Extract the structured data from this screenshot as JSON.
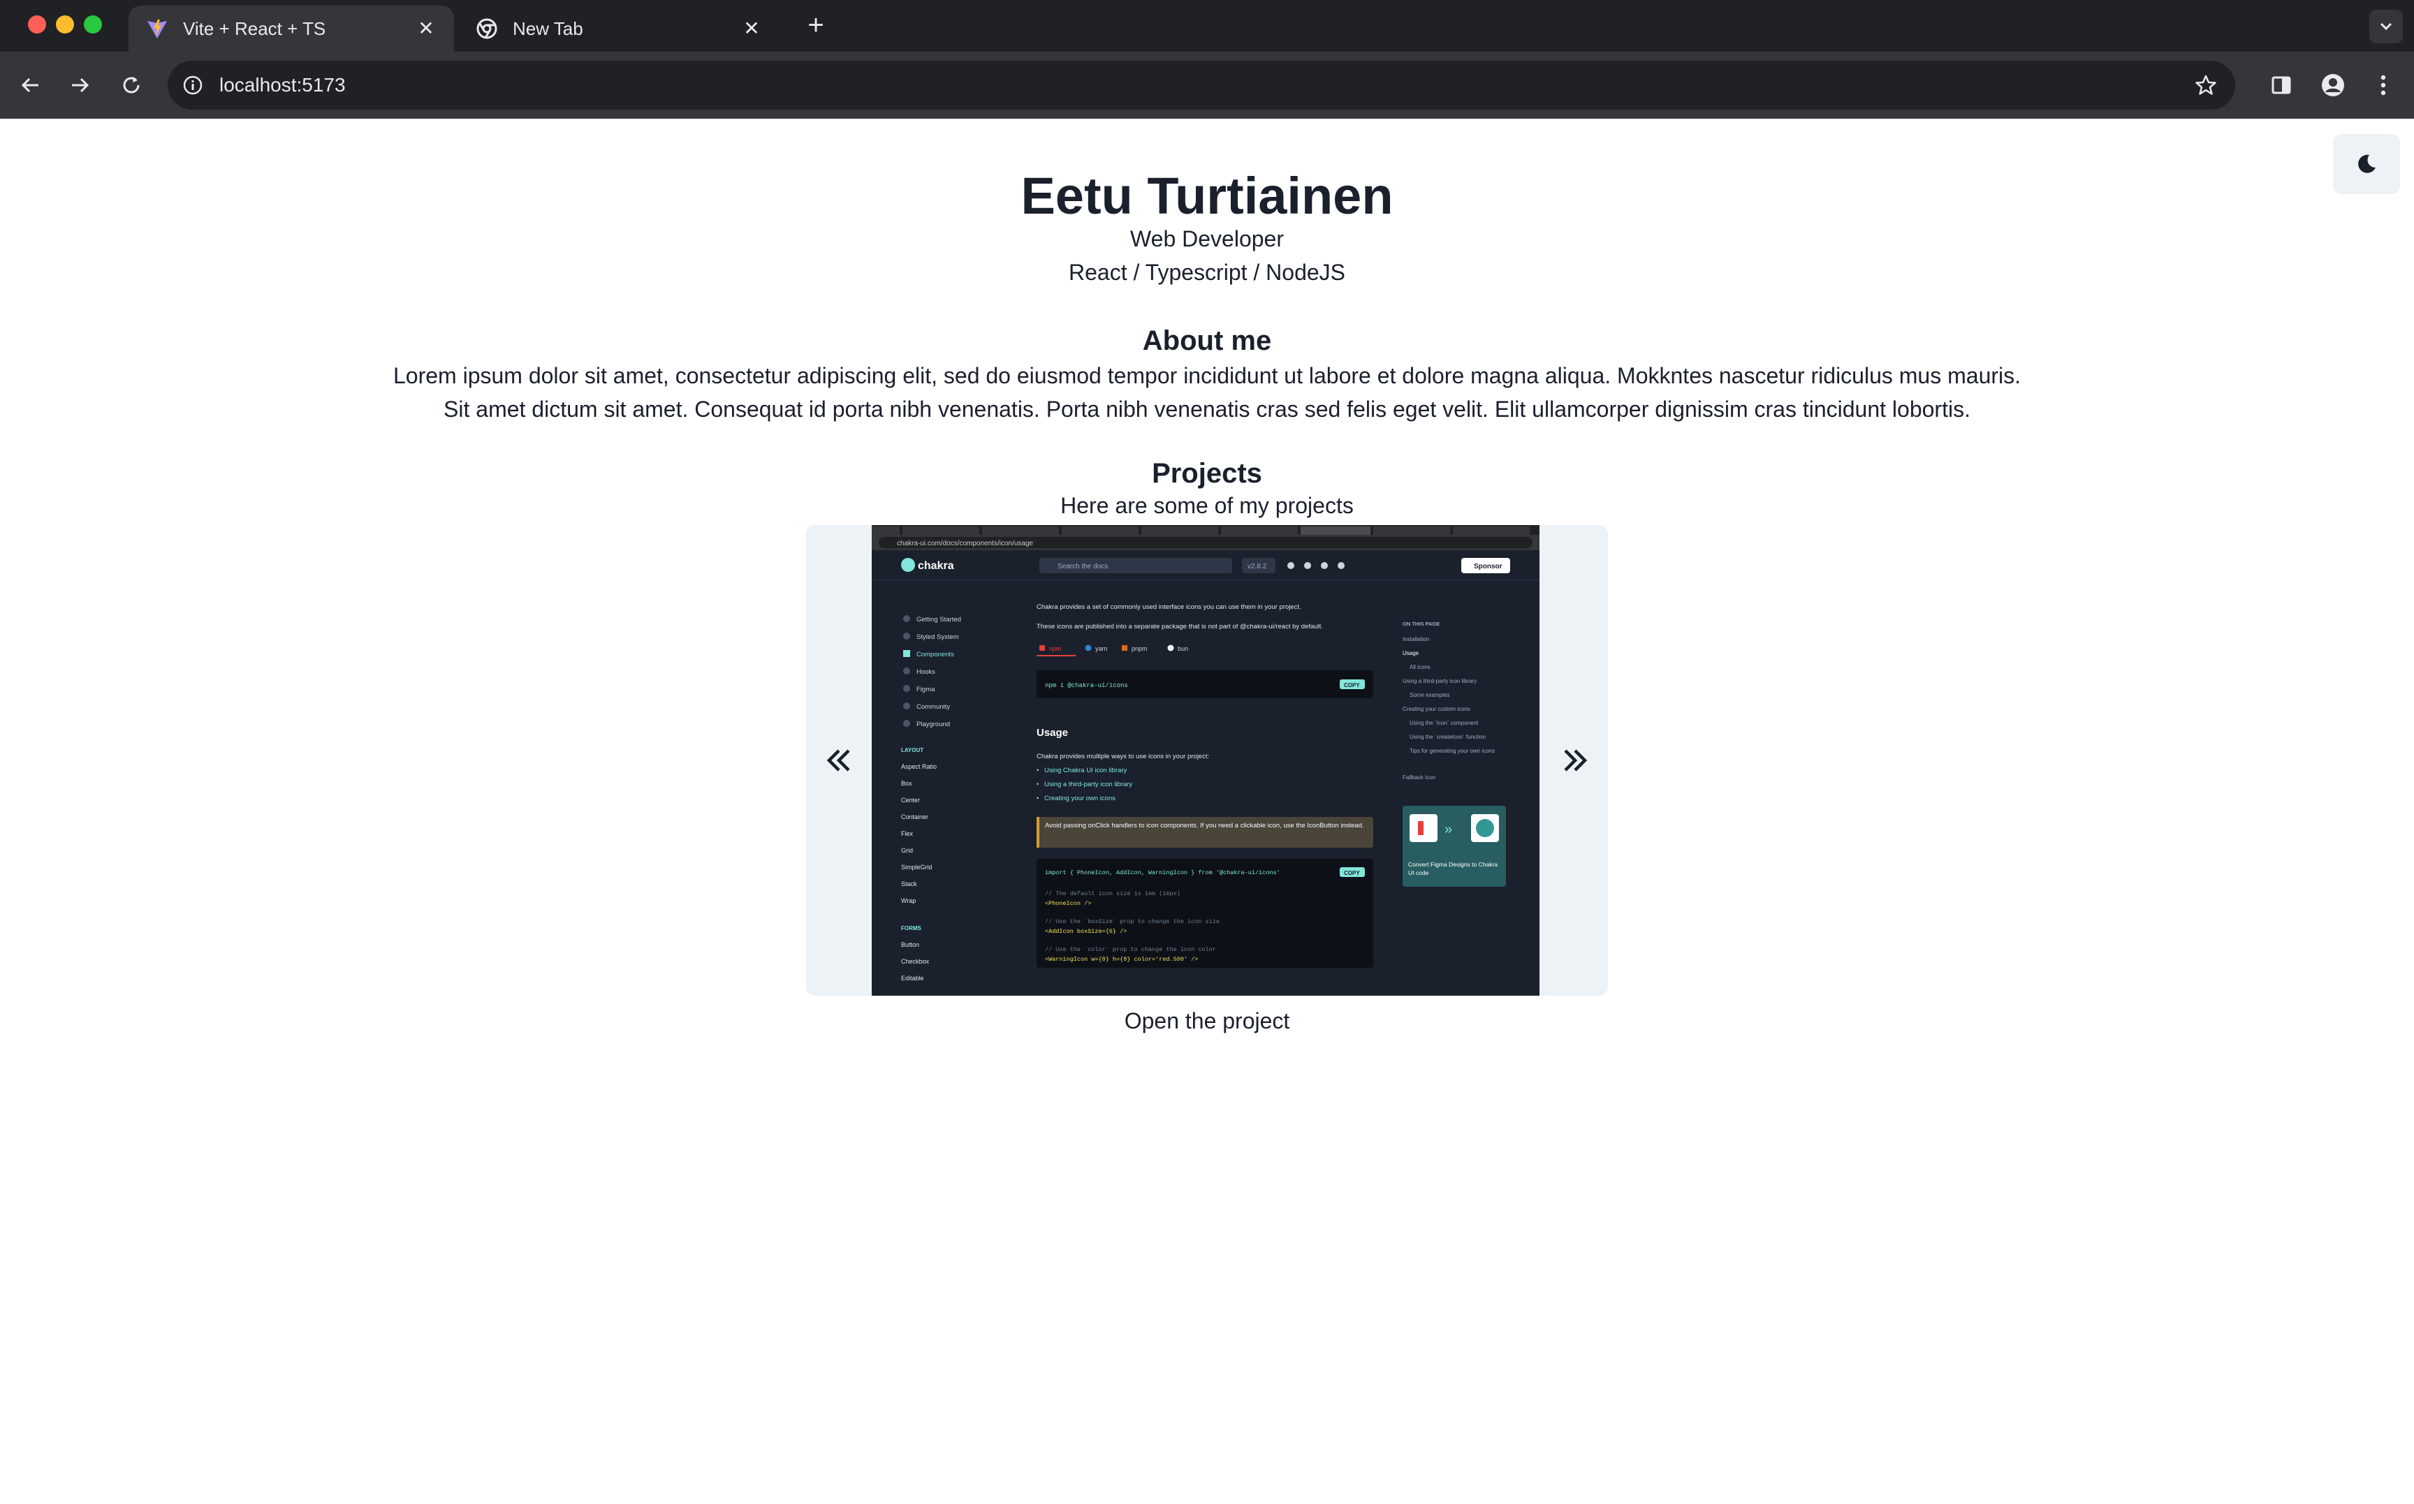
{
  "browser": {
    "tabs": [
      {
        "title": "Vite + React + TS",
        "icon": "vite-icon",
        "active": true
      },
      {
        "title": "New Tab",
        "icon": "chrome-icon",
        "active": false
      }
    ],
    "address": "localhost:5173"
  },
  "theme": {
    "toggle_icon": "moon-icon"
  },
  "header": {
    "name": "Eetu Turtiainen",
    "role": "Web Developer",
    "stack": "React / Typescript / NodeJS"
  },
  "about": {
    "title": "About me",
    "line1": "Lorem ipsum dolor sit amet, consectetur adipiscing elit, sed do eiusmod tempor incididunt ut labore et dolore magna aliqua. Mokkntes nascetur ridiculus mus mauris.",
    "line2": "Sit amet dictum sit amet. Consequat id porta nibh venenatis. Porta nibh venenatis cras sed felis eget velit. Elit ullamcorper dignissim cras tincidunt lobortis."
  },
  "projects": {
    "title": "Projects",
    "subtitle": "Here are some of my projects",
    "prev_icon": "double-chevron-left-icon",
    "next_icon": "double-chevron-right-icon",
    "link_label": "Open the project",
    "screenshot": {
      "url": "chakra-ui.com/docs/components/icon/usage",
      "logo": "chakra",
      "search_placeholder": "Search the docs",
      "version": "v2.8.2",
      "sponsor": "Sponsor",
      "sidebar_top": [
        "Getting Started",
        "Styled System",
        "Components",
        "Hooks",
        "Figma",
        "Community",
        "Playground"
      ],
      "layout_heading": "LAYOUT",
      "layout_items": [
        "Aspect Ratio",
        "Box",
        "Center",
        "Container",
        "Flex",
        "Grid",
        "SimpleGrid",
        "Stack",
        "Wrap"
      ],
      "forms_heading": "FORMS",
      "forms_items": [
        "Button",
        "Checkbox",
        "Editable"
      ],
      "intro": "Chakra provides a set of commonly used interface icons you can use them in your project.",
      "package_note": "These icons are published into a separate package that is not part of @chakra-ui/react by default.",
      "pm_tabs": [
        "npm",
        "yarn",
        "pnpm",
        "bun"
      ],
      "install_cmd": "npm i @chakra-ui/icons",
      "copy": "COPY",
      "usage_title": "Usage",
      "usage_text": "Chakra provides multiple ways to use icons in your project:",
      "usage_links": [
        "Using Chakra UI icon library",
        "Using a third-party icon library",
        "Creating your own icons"
      ],
      "warning": "Avoid passing onClick handlers to icon components. If you need a clickable icon, use the IconButton instead.",
      "code_lines": [
        "import { PhoneIcon, AddIcon, WarningIcon } from '@chakra-ui/icons'",
        "// The default icon size is 1em (16px)",
        "<PhoneIcon />",
        "// Use the `boxSize` prop to change the icon size",
        "<AddIcon boxSize={6} />",
        "// Use the `color` prop to change the icon color",
        "<WarningIcon w={8} h={8} color='red.500' />"
      ],
      "toc_heading": "ON THIS PAGE",
      "toc_items": [
        "Installation",
        "Usage",
        "All icons",
        "Using a third-party icon library",
        "Some examples",
        "Creating your custom icons",
        "Using the `Icon` component",
        "Using the `createIcon` function",
        "Tips for generating your own icons",
        "Fallback Icon"
      ],
      "promo": "Convert Figma Designs to Chakra UI code"
    }
  },
  "colors": {
    "chrome_dark": "#202124",
    "chrome_tab": "#35363a",
    "text": "#1a202c",
    "carousel_bg": "#edf2f7",
    "chakra_teal": "#81e6d9"
  }
}
